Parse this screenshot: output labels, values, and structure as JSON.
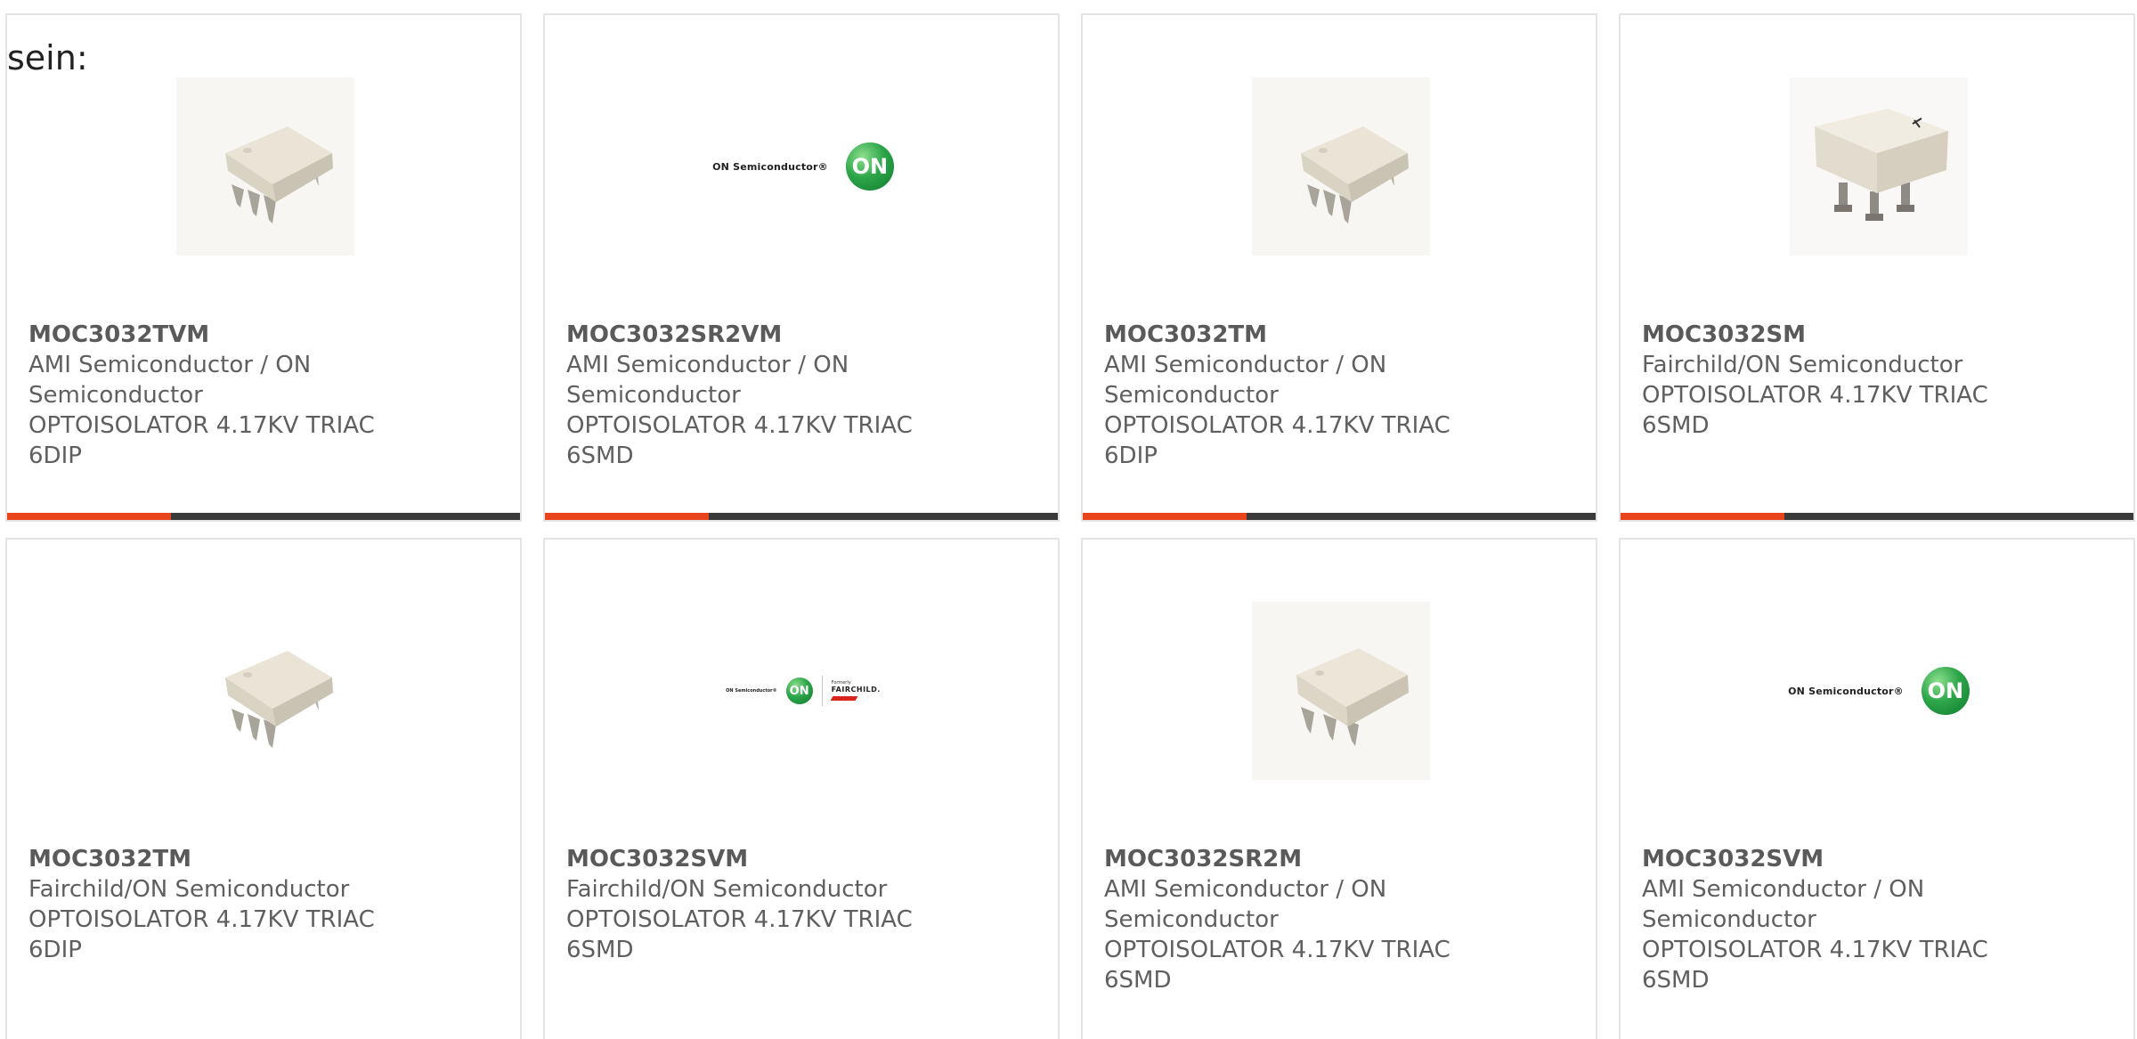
{
  "intro_text": "sein:",
  "colors": {
    "accent": "#e8451c",
    "bar": "#3a3a3a",
    "text": "#5f5f5f",
    "card_border": "#e4e4e4",
    "on_green": "#2da64a"
  },
  "cards": [
    {
      "part": "MOC3032TVM",
      "manufacturer": "AMI Semiconductor / ON Semiconductor",
      "description": "OPTOISOLATOR 4.17KV TRIAC 6DIP",
      "image": "dip6-chip-icon"
    },
    {
      "part": "MOC3032SR2VM",
      "manufacturer": "AMI Semiconductor / ON Semiconductor",
      "description": "OPTOISOLATOR 4.17KV TRIAC 6SMD",
      "image": "on-semiconductor-logo",
      "logo_text": "ON Semiconductor®",
      "logo_mark": "ON"
    },
    {
      "part": "MOC3032TM",
      "manufacturer": "AMI Semiconductor / ON Semiconductor",
      "description": "OPTOISOLATOR 4.17KV TRIAC 6DIP",
      "image": "dip6-chip-icon"
    },
    {
      "part": "MOC3032SM",
      "manufacturer": "Fairchild/ON Semiconductor",
      "description": "OPTOISOLATOR 4.17KV TRIAC 6SMD",
      "image": "smd6-chip-icon"
    },
    {
      "part": "MOC3032TM",
      "manufacturer": "Fairchild/ON Semiconductor",
      "description": "OPTOISOLATOR 4.17KV TRIAC 6DIP",
      "image": "dip6-chip-icon"
    },
    {
      "part": "MOC3032SVM",
      "manufacturer": "Fairchild/ON Semiconductor",
      "description": "OPTOISOLATOR 4.17KV TRIAC 6SMD",
      "image": "on-fairchild-logo",
      "logo_text": "ON Semiconductor®",
      "logo_mark": "ON",
      "logo_formerly": "Formerly",
      "logo_brand": "FAIRCHILD."
    },
    {
      "part": "MOC3032SR2M",
      "manufacturer": "AMI Semiconductor / ON Semiconductor",
      "description": "OPTOISOLATOR 4.17KV TRIAC 6SMD",
      "image": "smd6-chip-icon"
    },
    {
      "part": "MOC3032SVM",
      "manufacturer": "AMI Semiconductor / ON Semiconductor",
      "description": "OPTOISOLATOR 4.17KV TRIAC 6SMD",
      "image": "on-semiconductor-logo",
      "logo_text": "ON Semiconductor®",
      "logo_mark": "ON"
    }
  ]
}
